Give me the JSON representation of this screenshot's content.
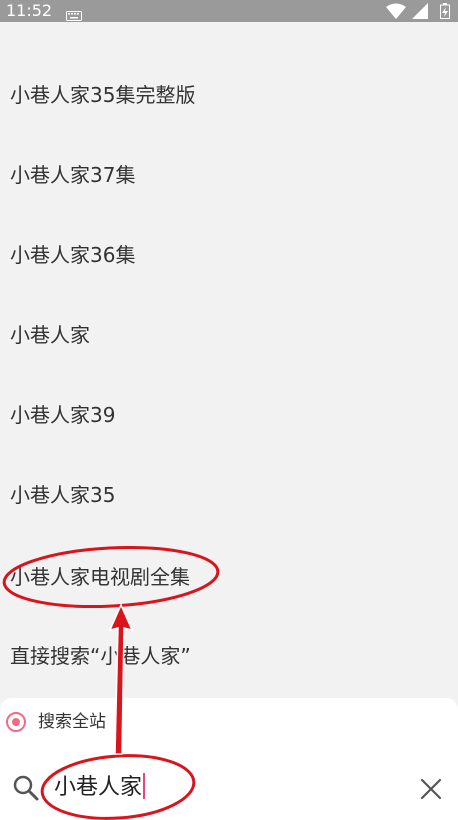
{
  "status_bar": {
    "time": "11:52"
  },
  "suggestions": [
    "小巷人家35集完整版",
    "小巷人家37集",
    "小巷人家36集",
    "小巷人家",
    "小巷人家39",
    "小巷人家35",
    "小巷人家电视剧全集",
    "直接搜索“小巷人家”"
  ],
  "search": {
    "scope_label": "搜索全站",
    "query": "小巷人家"
  },
  "colors": {
    "accent": "#f26a85",
    "annotation": "#d9141c",
    "caret": "#e8457a"
  },
  "icons": [
    "keyboard-icon",
    "wifi-icon",
    "signal-icon",
    "battery-icon",
    "radio-selected-icon",
    "search-icon",
    "close-icon"
  ]
}
